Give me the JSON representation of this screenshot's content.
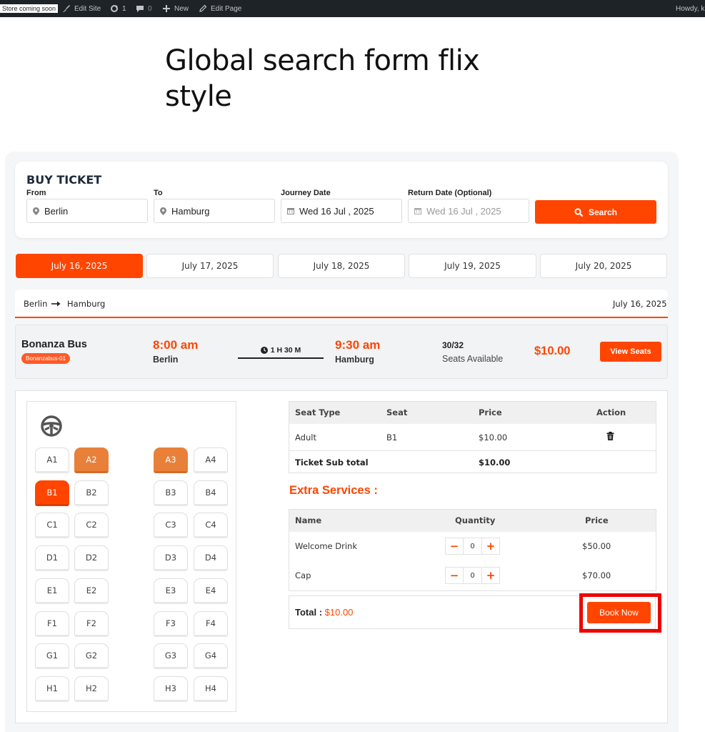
{
  "admin_bar": {
    "store_badge": "Store coming soon",
    "edit_site": "Edit Site",
    "updates_count": "1",
    "comments_count": "0",
    "new_label": "New",
    "edit_page": "Edit Page",
    "howdy": "Howdy, k"
  },
  "page_title": "Global search form flix style",
  "search": {
    "title": "BUY TICKET",
    "from_label": "From",
    "from_value": "Berlin",
    "to_label": "To",
    "to_value": "Hamburg",
    "journey_label": "Journey Date",
    "journey_value": "Wed 16 Jul , 2025",
    "return_label": "Return Date (Optional)",
    "return_placeholder": "Wed 16 Jul , 2025",
    "button": "Search"
  },
  "date_tabs": [
    "July 16, 2025",
    "July 17, 2025",
    "July 18, 2025",
    "July 19, 2025",
    "July 20, 2025"
  ],
  "route": {
    "from": "Berlin",
    "to": "Hamburg",
    "date": "July 16, 2025"
  },
  "bus": {
    "name": "Bonanza Bus",
    "code": "Bonanzabus-01",
    "depart_time": "8:00 am",
    "depart_city": "Berlin",
    "duration": "1 H 30 M",
    "arrive_time": "9:30 am",
    "arrive_city": "Hamburg",
    "seat_count": "30/32",
    "seats_available": "Seats Available",
    "price": "$10.00",
    "view_seats": "View Seats"
  },
  "seat_map": {
    "rows": [
      [
        "A1",
        "A2",
        "A3",
        "A4"
      ],
      [
        "B1",
        "B2",
        "B3",
        "B4"
      ],
      [
        "C1",
        "C2",
        "C3",
        "C4"
      ],
      [
        "D1",
        "D2",
        "D3",
        "D4"
      ],
      [
        "E1",
        "E2",
        "E3",
        "E4"
      ],
      [
        "F1",
        "F2",
        "F3",
        "F4"
      ],
      [
        "G1",
        "G2",
        "G3",
        "G4"
      ],
      [
        "H1",
        "H2",
        "H3",
        "H4"
      ]
    ],
    "booked": [
      "A2",
      "A3"
    ],
    "selected": [
      "B1"
    ],
    "colors": {
      "booked": "#e8803a",
      "selected": "#ff4500"
    }
  },
  "ticket_table": {
    "headers": [
      "Seat Type",
      "Seat",
      "Price",
      "Action"
    ],
    "row": {
      "type": "Adult",
      "seat": "B1",
      "price": "$10.00"
    },
    "subtotal_label": "Ticket Sub total",
    "subtotal_value": "$10.00"
  },
  "extra": {
    "title": "Extra Services :",
    "headers": [
      "Name",
      "Quantity",
      "Price"
    ],
    "items": [
      {
        "name": "Welcome Drink",
        "qty": "0",
        "price": "$50.00"
      },
      {
        "name": "Cap",
        "qty": "0",
        "price": "$70.00"
      }
    ]
  },
  "total": {
    "label": "Total : ",
    "value": "$10.00",
    "button": "Book Now"
  },
  "theme": {
    "accent": "#ff4500",
    "highlight": "#ee0000"
  }
}
